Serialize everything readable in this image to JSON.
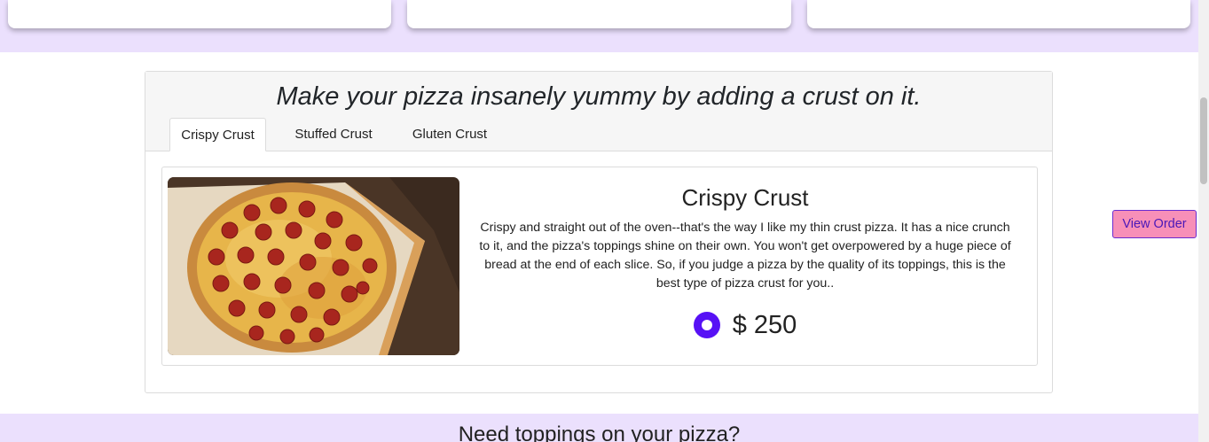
{
  "crust_section": {
    "title": "Make your pizza insanely yummy by adding a crust on it.",
    "tabs": [
      {
        "label": "Crispy Crust",
        "active": true
      },
      {
        "label": "Stuffed Crust",
        "active": false
      },
      {
        "label": "Gluten Crust",
        "active": false
      }
    ],
    "selected": {
      "name": "Crispy Crust",
      "description": "Crispy and straight out of the oven--that's the way I like my thin crust pizza. It has a nice crunch to it, and the pizza's toppings shine on their own. You won't get overpowered by a huge piece of bread at the end of each slice. So, if you judge a pizza by the quality of its toppings, this is the best type of pizza crust for you..",
      "price": "$ 250",
      "radio_selected": true
    }
  },
  "view_order_label": "View Order",
  "toppings_section": {
    "title": "Need toppings on your pizza?"
  },
  "colors": {
    "band": "#ebe0fd",
    "radio": "#5711f5",
    "view_order_bg": "#f78fb8",
    "view_order_border": "#6a2bd0"
  }
}
